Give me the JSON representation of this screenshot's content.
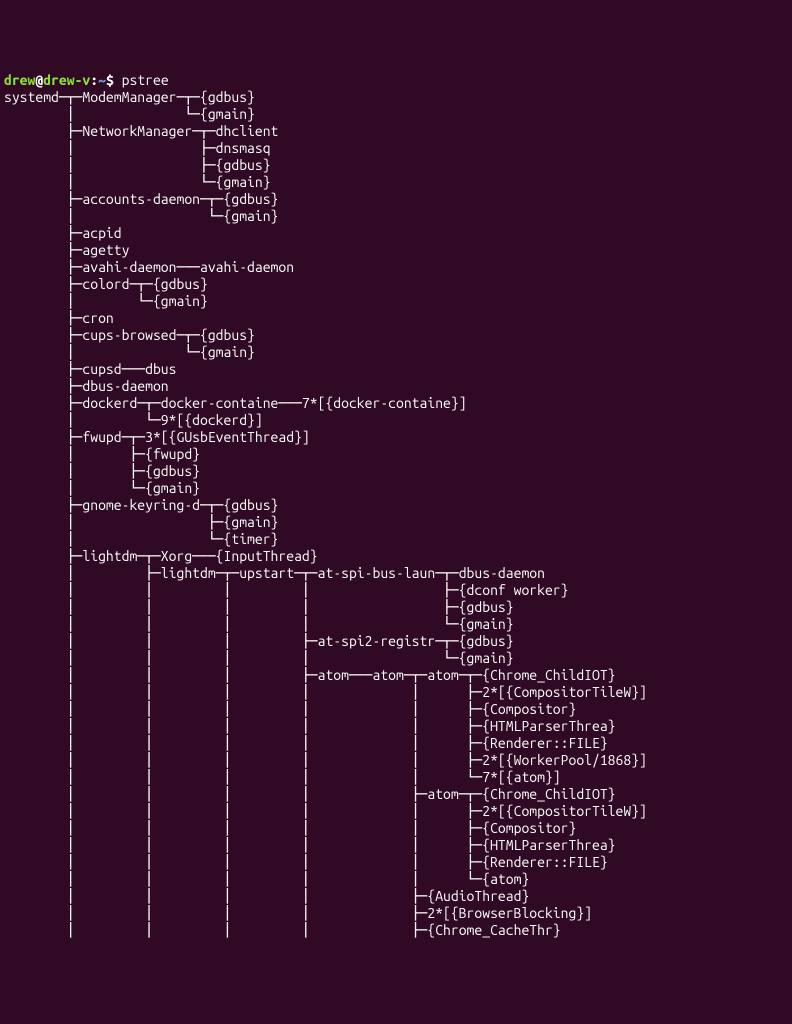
{
  "prompt": {
    "user": "drew",
    "at": "@",
    "host": "drew-v",
    "colon": ":",
    "cwd": "~",
    "dollar": "$ ",
    "command": "pstree"
  },
  "lines": [
    "systemd─┬─ModemManager─┬─{gdbus}",
    "        │              └─{gmain}",
    "        ├─NetworkManager─┬─dhclient",
    "        │                ├─dnsmasq",
    "        │                ├─{gdbus}",
    "        │                └─{gmain}",
    "        ├─accounts-daemon─┬─{gdbus}",
    "        │                 └─{gmain}",
    "        ├─acpid",
    "        ├─agetty",
    "        ├─avahi-daemon───avahi-daemon",
    "        ├─colord─┬─{gdbus}",
    "        │        └─{gmain}",
    "        ├─cron",
    "        ├─cups-browsed─┬─{gdbus}",
    "        │              └─{gmain}",
    "        ├─cupsd───dbus",
    "        ├─dbus-daemon",
    "        ├─dockerd─┬─docker-containe───7*[{docker-containe}]",
    "        │         └─9*[{dockerd}]",
    "        ├─fwupd─┬─3*[{GUsbEventThread}]",
    "        │       ├─{fwupd}",
    "        │       ├─{gdbus}",
    "        │       └─{gmain}",
    "        ├─gnome-keyring-d─┬─{gdbus}",
    "        │                 ├─{gmain}",
    "        │                 └─{timer}",
    "        ├─lightdm─┬─Xorg───{InputThread}",
    "        │         ├─lightdm─┬─upstart─┬─at-spi-bus-laun─┬─dbus-daemon",
    "        │         │         │         │                 ├─{dconf worker}",
    "        │         │         │         │                 ├─{gdbus}",
    "        │         │         │         │                 └─{gmain}",
    "        │         │         │         ├─at-spi2-registr─┬─{gdbus}",
    "        │         │         │         │                 └─{gmain}",
    "        │         │         │         ├─atom───atom─┬─atom─┬─{Chrome_ChildIOT}",
    "        │         │         │         │             │      ├─2*[{CompositorTileW}]",
    "        │         │         │         │             │      ├─{Compositor}",
    "        │         │         │         │             │      ├─{HTMLParserThrea}",
    "        │         │         │         │             │      ├─{Renderer::FILE}",
    "        │         │         │         │             │      ├─2*[{WorkerPool/1868}]",
    "        │         │         │         │             │      └─7*[{atom}]",
    "        │         │         │         │             ├─atom─┬─{Chrome_ChildIOT}",
    "        │         │         │         │             │      ├─2*[{CompositorTileW}]",
    "        │         │         │         │             │      ├─{Compositor}",
    "        │         │         │         │             │      ├─{HTMLParserThrea}",
    "        │         │         │         │             │      ├─{Renderer::FILE}",
    "        │         │         │         │             │      └─{atom}",
    "        │         │         │         │             ├─{AudioThread}",
    "        │         │         │         │             ├─2*[{BrowserBlocking}]",
    "        │         │         │         │             ├─{Chrome_CacheThr}"
  ]
}
